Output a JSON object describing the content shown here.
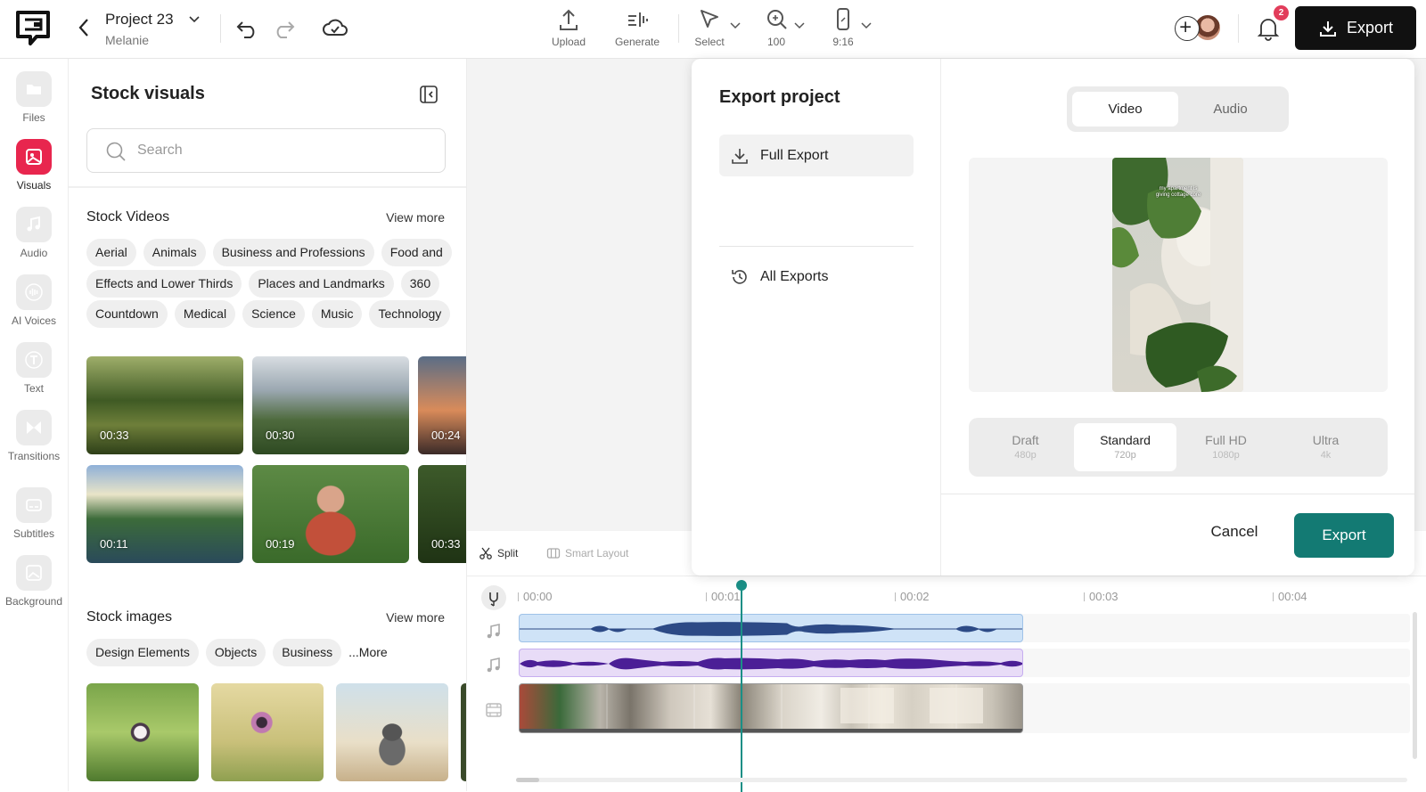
{
  "header": {
    "project_title": "Project 23",
    "project_owner": "Melanie",
    "tools": [
      {
        "label": "Upload",
        "icon": "upload-icon"
      },
      {
        "label": "Generate",
        "icon": "generate-icon"
      },
      {
        "label": "Select",
        "icon": "cursor-icon"
      },
      {
        "label": "100",
        "icon": "zoom-icon"
      },
      {
        "label": "9:16",
        "icon": "phone-aspect-icon"
      }
    ],
    "notification_count": "2",
    "export_label": "Export"
  },
  "sidebar": {
    "items": [
      {
        "label": "Files",
        "icon": "folder-icon"
      },
      {
        "label": "Visuals",
        "icon": "visuals-icon",
        "active": true
      },
      {
        "label": "Audio",
        "icon": "music-note-icon"
      },
      {
        "label": "AI Voices",
        "icon": "waveform-icon"
      },
      {
        "label": "Text",
        "icon": "text-icon"
      },
      {
        "label": "Transitions",
        "icon": "transitions-icon"
      },
      {
        "label": "Subtitles",
        "icon": "subtitles-icon"
      },
      {
        "label": "Background",
        "icon": "background-icon"
      }
    ]
  },
  "panel": {
    "title": "Stock visuals",
    "search_placeholder": "Search",
    "stock_videos": {
      "title": "Stock Videos",
      "view_more": "View more",
      "chip_rows": [
        [
          "Aerial",
          "Animals",
          "Business and Professions",
          "Food and"
        ],
        [
          "Effects and Lower Thirds",
          "Places and Landmarks",
          "360"
        ],
        [
          "Countdown",
          "Medical",
          "Science",
          "Music",
          "Technology"
        ]
      ],
      "durations": [
        "00:33",
        "00:30",
        "00:24",
        "00:11",
        "00:19",
        "00:33"
      ]
    },
    "stock_images": {
      "title": "Stock images",
      "view_more": "View more",
      "chips": [
        "Design Elements",
        "Objects",
        "Business",
        "...More"
      ]
    }
  },
  "export_modal": {
    "title": "Export project",
    "menu": [
      {
        "label": "Full Export",
        "icon": "download-icon",
        "active": true
      },
      {
        "label": "All Exports",
        "icon": "history-icon"
      }
    ],
    "format_tabs": [
      {
        "label": "Video",
        "active": true
      },
      {
        "label": "Audio"
      }
    ],
    "preview_caption": "my apartment is giving cottage core",
    "quality_options": [
      {
        "label": "Draft",
        "sub": "480p"
      },
      {
        "label": "Standard",
        "sub": "720p",
        "active": true
      },
      {
        "label": "Full HD",
        "sub": "1080p"
      },
      {
        "label": "Ultra",
        "sub": "4k"
      }
    ],
    "cancel_label": "Cancel",
    "export_label": "Export"
  },
  "timeline": {
    "toolbar": {
      "split": "Split",
      "smart_layout": "Smart Layout"
    },
    "ticks": [
      "00:00",
      "00:01",
      "00:02",
      "00:03",
      "00:04"
    ]
  },
  "colors": {
    "accent": "#137a73",
    "active_nav": "#e8264e",
    "audio_track_1": "#cfe3f7",
    "audio_wave_1": "#2d4a86",
    "audio_track_2": "#e8dcf7",
    "audio_wave_2": "#4b1f96"
  }
}
